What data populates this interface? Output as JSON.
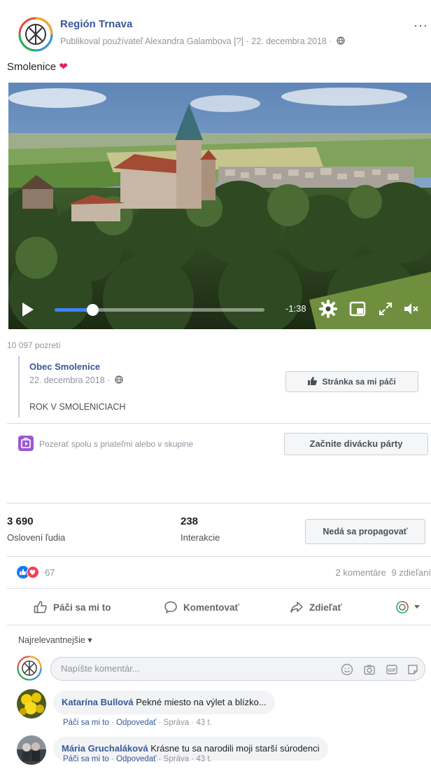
{
  "post": {
    "page_name": "Región Trnava",
    "byline": "Publikoval používateľ Alexandra Galambova [?] · 22. decembra 2018 ·",
    "caption": "Smolenice",
    "caption_emoji": "❤"
  },
  "video": {
    "time_remaining": "-1:38",
    "progress": 0.18,
    "views": "10 097 pozretí"
  },
  "shared": {
    "name": "Obec Smolenice",
    "date": "22. decembra 2018 ·",
    "text": "ROK V SMOLENICIACH",
    "like_page_label": "Stránka sa mi páči"
  },
  "watch_party": {
    "text": "Pozerať spolu s priateľmi alebo v skupine",
    "button": "Začnite divácku párty"
  },
  "insights": {
    "reach_value": "3 690",
    "reach_label": "Oslovení ľudia",
    "interactions_value": "238",
    "interactions_label": "Interakcie",
    "promote_button": "Nedá sa propagovať"
  },
  "reactions": {
    "count": "67",
    "comments": "2 komentáre",
    "shares": "9 zdieľaní"
  },
  "actions": {
    "like": "Páči sa mi to",
    "comment": "Komentovať",
    "share": "Zdieľať"
  },
  "comments_section": {
    "sort_label": "Najrelevantnejšie ▾",
    "composer_placeholder": "Napíšte komentár..."
  },
  "comments": [
    {
      "author": "Katarína Bullová",
      "text": "Pekné miesto na výlet a blízko...",
      "like": "Páči sa mi to",
      "reply": "Odpovedať",
      "tail": "· Správa · 43 t."
    },
    {
      "author": "Mária Gruchaláková",
      "text": "Krásne tu sa narodili moji starší súrodenci",
      "like": "Páči sa mi to",
      "reply": "Odpovedať",
      "tail": "· Správa · 43 t."
    }
  ],
  "colors": {
    "link": "#385898",
    "like_blue": "#1877f2",
    "love_red": "#f33e58",
    "progress": "#4080ff"
  }
}
